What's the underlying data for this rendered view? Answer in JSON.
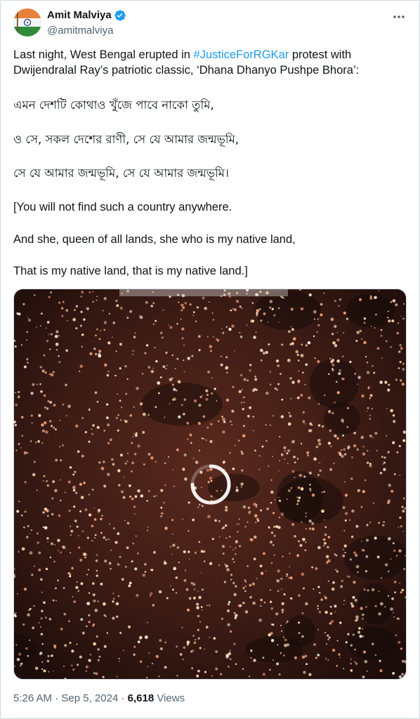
{
  "author": {
    "display_name": "Amit Malviya",
    "handle": "@amitmalviya",
    "verified": true,
    "avatar_icon": "india-flag-avatar-icon"
  },
  "more_icon": "more-options-icon",
  "tweet": {
    "intro_before": "Last night, West Bengal erupted in ",
    "hashtag": "#JusticeForRGKar",
    "intro_after": " protest with",
    "intro_line2": "Dwijendralal Ray’s patriotic classic, ‘Dhana Dhanyo Pushpe Bhora’:",
    "bengali_lines": [
      "এমন দেশটি কোথাও খুঁজে পাবে নাকো তুমি,",
      "ও সে, সকল দেশের রাণী, সে যে আমার জন্মভূমি,",
      "সে যে আমার জন্মভূমি, সে যে আমার জন্মভূমি।"
    ],
    "translation_lines": [
      "[You will not find such a country anywhere.",
      "And she, queen of all lands, she who is my native land,",
      "That is my native land, that is my native land.]"
    ]
  },
  "media": {
    "type": "video",
    "state": "loading",
    "spinner_icon": "loading-spinner-icon"
  },
  "meta": {
    "time": "5:26 AM",
    "separator": "·",
    "date": "Sep 5, 2024",
    "views_count": "6,618",
    "views_label": "Views"
  },
  "colors": {
    "link": "#1d9bf0",
    "secondary_text": "#536471",
    "primary_text": "#0f1419",
    "verified_badge": "#1d9bf0"
  }
}
